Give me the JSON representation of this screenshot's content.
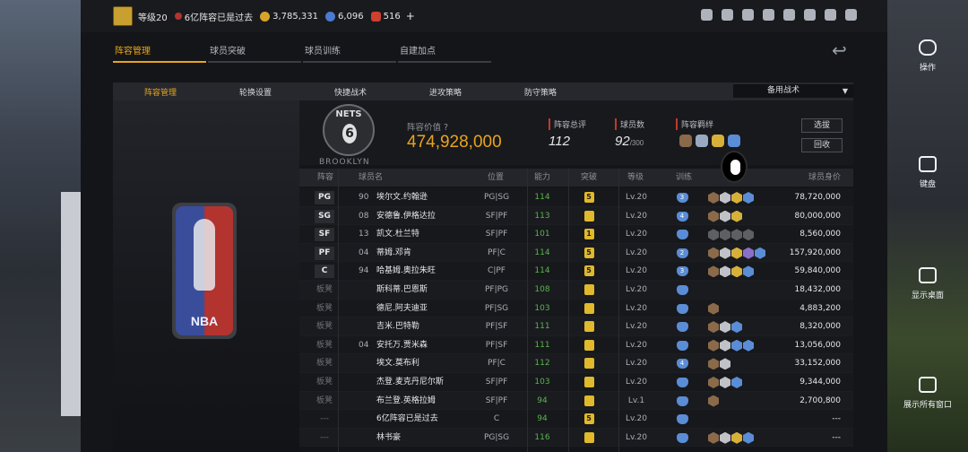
{
  "topbar": {
    "level": "等级20",
    "team_name": "6亿阵容已是过去",
    "coins": "3,785,331",
    "stars": "6,096",
    "gems": "516",
    "plus": "+"
  },
  "nav": {
    "tabs": [
      "阵容管理",
      "球员突破",
      "球员训练",
      "自建加点"
    ]
  },
  "subnav": {
    "tabs": [
      "阵容管理",
      "轮换设置",
      "快捷战术",
      "进攻策略",
      "防守策略"
    ],
    "bench_tactics": "备用战术"
  },
  "team": {
    "logo_text": "NETS",
    "logo_sub": "BROOKLYN",
    "value_label": "阵容价值",
    "value": "474,928,000",
    "rating_label": "阵容总评",
    "rating": "112",
    "count_label": "球员数",
    "count": "92",
    "count_max": "/300",
    "bond_label": "阵容羁绊",
    "btn_select": "选拔",
    "btn_recycle": "回收"
  },
  "league_logo": "NBA",
  "table": {
    "headers": [
      "阵容",
      "球员名",
      "位置",
      "能力",
      "突破",
      "等级",
      "训练",
      "球员身价"
    ],
    "rows": [
      {
        "slot": "PG",
        "num": "90",
        "name": "埃尔文.约翰逊",
        "pos": "PG|SG",
        "ability": "114",
        "break": "5",
        "level": "Lv.20",
        "train": "3",
        "salary": "78,720,000",
        "chips": [
          "#8a6a4a",
          "#c0c2c8",
          "#d7b03a",
          "#5a8dd6"
        ]
      },
      {
        "slot": "SG",
        "num": "08",
        "name": "安德鲁.伊格达拉",
        "pos": "SF|PF",
        "ability": "113",
        "break": "",
        "level": "Lv.20",
        "train": "4",
        "salary": "80,000,000",
        "chips": [
          "#8a6a4a",
          "#c0c2c8",
          "#d7b03a"
        ]
      },
      {
        "slot": "SF",
        "num": "13",
        "name": "凯文.杜兰特",
        "pos": "SF|PF",
        "ability": "101",
        "break": "1",
        "level": "Lv.20",
        "train": "",
        "salary": "8,560,000",
        "chips": [
          "#5e5f63",
          "#5e5f63",
          "#5e5f63",
          "#5e5f63"
        ]
      },
      {
        "slot": "PF",
        "num": "04",
        "name": "蒂姆.邓肯",
        "pos": "PF|C",
        "ability": "114",
        "break": "5",
        "level": "Lv.20",
        "train": "2",
        "salary": "157,920,000",
        "chips": [
          "#8a6a4a",
          "#c0c2c8",
          "#d7b03a",
          "#8a6fc9",
          "#5a8dd6"
        ]
      },
      {
        "slot": "C",
        "num": "94",
        "name": "哈基姆.奥拉朱旺",
        "pos": "C|PF",
        "ability": "114",
        "break": "5",
        "level": "Lv.20",
        "train": "3",
        "salary": "59,840,000",
        "chips": [
          "#8a6a4a",
          "#c0c2c8",
          "#d7b03a",
          "#5a8dd6"
        ]
      },
      {
        "slot": "板凳",
        "num": "",
        "name": "斯科蒂.巴恩斯",
        "pos": "PF|PG",
        "ability": "108",
        "break": "",
        "level": "Lv.20",
        "train": "",
        "salary": "18,432,000",
        "chips": []
      },
      {
        "slot": "板凳",
        "num": "",
        "name": "德尼.阿夫迪亚",
        "pos": "PF|SG",
        "ability": "103",
        "break": "",
        "level": "Lv.20",
        "train": "",
        "salary": "4,883,200",
        "chips": [
          "#8a6a4a"
        ]
      },
      {
        "slot": "板凳",
        "num": "",
        "name": "吉米.巴特勒",
        "pos": "PF|SF",
        "ability": "111",
        "break": "",
        "level": "Lv.20",
        "train": "",
        "salary": "8,320,000",
        "chips": [
          "#8a6a4a",
          "#c0c2c8",
          "#5a8dd6"
        ]
      },
      {
        "slot": "板凳",
        "num": "04",
        "name": "安托万.贾米森",
        "pos": "PF|SF",
        "ability": "111",
        "break": "",
        "level": "Lv.20",
        "train": "",
        "salary": "13,056,000",
        "chips": [
          "#8a6a4a",
          "#c0c2c8",
          "#5a8dd6",
          "#5a8dd6"
        ]
      },
      {
        "slot": "板凳",
        "num": "",
        "name": "埃文.莫布利",
        "pos": "PF|C",
        "ability": "112",
        "break": "",
        "level": "Lv.20",
        "train": "4",
        "salary": "33,152,000",
        "chips": [
          "#8a6a4a",
          "#c0c2c8"
        ]
      },
      {
        "slot": "板凳",
        "num": "",
        "name": "杰登.麦克丹尼尔斯",
        "pos": "SF|PF",
        "ability": "103",
        "break": "",
        "level": "Lv.20",
        "train": "",
        "salary": "9,344,000",
        "chips": [
          "#8a6a4a",
          "#c0c2c8",
          "#5a8dd6"
        ]
      },
      {
        "slot": "板凳",
        "num": "",
        "name": "布兰登.英格拉姆",
        "pos": "SF|PF",
        "ability": "94",
        "break": "",
        "level": "Lv.1",
        "train": "",
        "salary": "2,700,800",
        "chips": [
          "#8a6a4a"
        ]
      },
      {
        "slot": "---",
        "num": "",
        "name": "6亿阵容已是过去",
        "pos": "C",
        "ability": "94",
        "break": "5",
        "level": "Lv.20",
        "train": "",
        "salary": "---",
        "chips": []
      },
      {
        "slot": "---",
        "num": "",
        "name": "林书豪",
        "pos": "PG|SG",
        "ability": "116",
        "break": "",
        "level": "Lv.20",
        "train": "",
        "salary": "---",
        "chips": [
          "#8a6a4a",
          "#c0c2c8",
          "#d7b03a",
          "#5a8dd6"
        ]
      }
    ]
  },
  "side_toolbar": [
    "操作",
    "键盘",
    "显示桌面",
    "展示所有窗口"
  ]
}
